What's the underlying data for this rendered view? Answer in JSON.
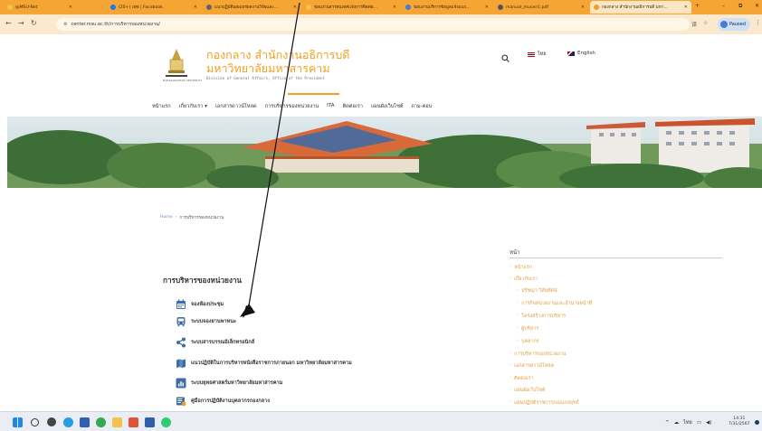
{
  "browser": {
    "tabs": [
      {
        "label": "@MSU-Net",
        "color": "#f2c14e"
      },
      {
        "label": "(20+) เฟซ | Facebook",
        "color": "#1877f2"
      },
      {
        "label": "แนวปฏิบัติเผยแพร่ผลงานวิจัยและ...",
        "color": "#666666"
      },
      {
        "label": "ขอบงานสารสนเทศแจ้งการติดต่อ...",
        "color": "#f2c14e"
      },
      {
        "label": "ขอบงานบริการข้อมูลแจ้งแนว...",
        "color": "#4a7bd0"
      },
      {
        "label": "manual_mucen1.pdf",
        "color": "#555555"
      },
      {
        "label": "กองกลาง สำนักงานอธิการบดี มหา...",
        "color": "#f0a020"
      }
    ],
    "new_tab": "+",
    "url": "center.msu.ac.th/การบริหารของหน่วยงาน/",
    "profile": "Paused",
    "window_controls": [
      "–",
      "⧉",
      "✕"
    ]
  },
  "site": {
    "title_th_line1": "กองกลาง สำนักงานอธิการบดี",
    "title_th_line2": "มหาวิทยาลัยมหาสารคาม",
    "title_en": "Division of General Affairs, Office of the President",
    "logo_caption": "MAHASARAKHAM UNIVERSITY",
    "lang_th": "ไทย",
    "lang_en": "English",
    "nav": [
      "หน้าแรก",
      "เกี่ยวกับเรา ▾",
      "เอกสารดาวน์โหลด",
      "การบริหารของหน่วยงาน",
      "ITA",
      "ติดต่อเรา",
      "แผนผังเว็บไซต์",
      "ถาม-ตอบ"
    ],
    "breadcrumb": {
      "home": "Home",
      "sep": "›",
      "current": "การบริหารของหน่วยงาน"
    }
  },
  "content": {
    "section_title": "การบริหารของหน่วยงาน",
    "items": [
      {
        "label": "จองห้องประชุม",
        "icon": "calendar-icon"
      },
      {
        "label": "ระบบจองยานพาหนะ",
        "icon": "bus-icon"
      },
      {
        "label": "ระบบสารบรรณอิเล็กทรอนิกส์",
        "icon": "share-icon"
      },
      {
        "label": "แนวปฏิบัติในการบริหารหนังสือราชการภายนอก มหาวิทยาลัยมหาสารคาม",
        "icon": "map-icon"
      },
      {
        "label": "ระบบยุทธศาสตร์มหาวิทยาลัยมหาสารคาม",
        "icon": "chart-icon"
      },
      {
        "label": "คู่มือการปฏิบัติงานบุคลากรกองกลาง",
        "icon": "book-icon"
      }
    ]
  },
  "sidebar": {
    "title": "หน้า",
    "items": [
      {
        "label": "หน้าแรก",
        "indent": 0
      },
      {
        "label": "เกี่ยวกับเรา",
        "indent": 0
      },
      {
        "label": "ปรัชญา วิสัยทัศน์",
        "indent": 1
      },
      {
        "label": "การกิจหน่วยงานและอำนาจหน้าที่",
        "indent": 1
      },
      {
        "label": "โครงสร้างการบริหาร",
        "indent": 1
      },
      {
        "label": "ผู้บริหาร",
        "indent": 1
      },
      {
        "label": "บุคลากร",
        "indent": 1
      },
      {
        "label": "การบริหารของหน่วยงาน",
        "indent": 0
      },
      {
        "label": "เอกสารดาวน์โหลด",
        "indent": 0
      },
      {
        "label": "ติดต่อเรา",
        "indent": 0
      },
      {
        "label": "แผนผังเว็บไซต์",
        "indent": 0
      },
      {
        "label": "แผนปฏิบัติราชการ/แผนกลยุทธ์",
        "indent": 0
      }
    ]
  },
  "taskbar": {
    "tray_lang": "ไทย",
    "time": "14:31",
    "date": "7/31/2567"
  },
  "colors": {
    "accent": "#f0a020",
    "tabbar": "#f4a533",
    "link": "#e0a040"
  }
}
